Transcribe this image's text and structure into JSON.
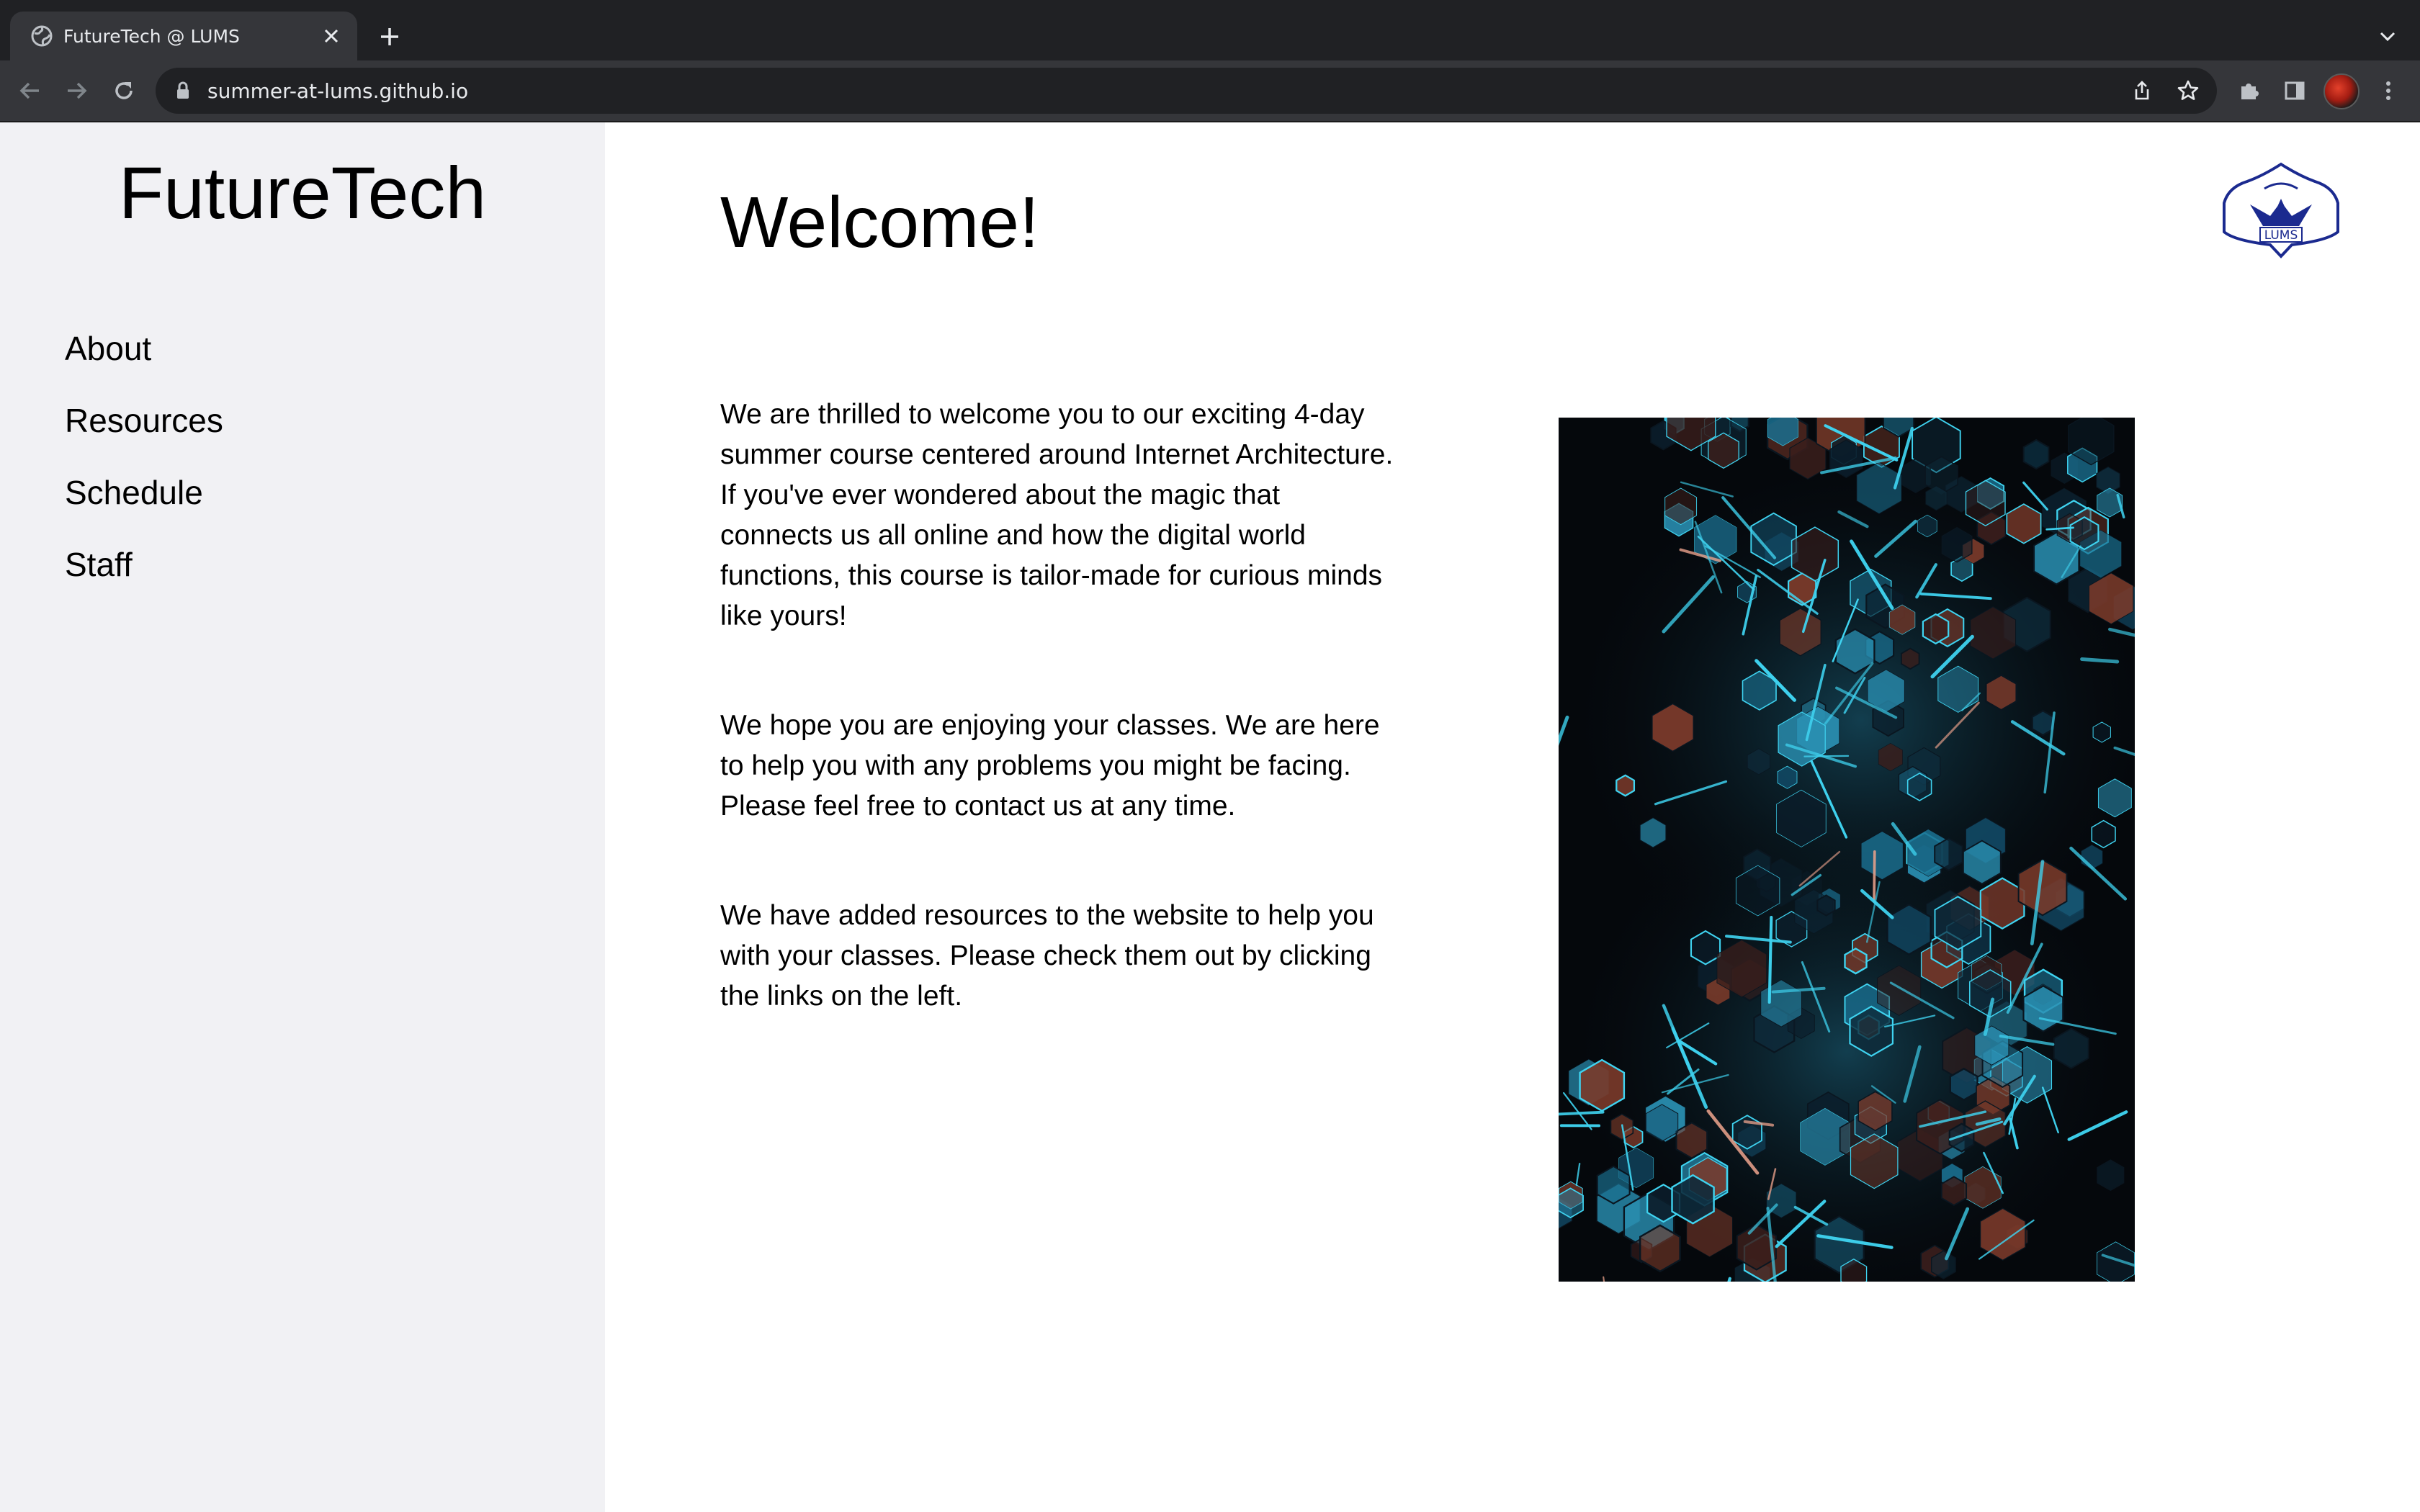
{
  "browser": {
    "tab_title": "FutureTech @ LUMS",
    "url": "summer-at-lums.github.io"
  },
  "sidebar": {
    "brand": "FutureTech",
    "links": [
      {
        "label": "About"
      },
      {
        "label": "Resources"
      },
      {
        "label": "Schedule"
      },
      {
        "label": "Staff"
      }
    ]
  },
  "main": {
    "title": "Welcome!",
    "logo_text": "LUMS",
    "paragraphs": [
      "We are thrilled to welcome you to our exciting 4-day summer course centered around Internet Architecture. If you've ever wondered about the magic that connects us all online and how the digital world functions, this course is tailor-made for curious minds like yours!",
      "We hope you are enjoying your classes. We are here to help you with any problems you might be facing. Please feel free to contact us at any time.",
      "We have added resources to the website to help you with your classes. Please check them out by clicking the links on the left."
    ]
  },
  "colors": {
    "sidebar_bg": "#f1f1f4",
    "chrome_dark": "#202124",
    "chrome_toolbar": "#35363a",
    "logo_blue": "#1b2a8f",
    "hero_accent": "#3fd3f0"
  },
  "icons": [
    "globe-icon",
    "close-icon",
    "plus-icon",
    "chevron-down-icon",
    "back-icon",
    "forward-icon",
    "reload-icon",
    "lock-icon",
    "share-icon",
    "star-icon",
    "extensions-icon",
    "side-panel-icon",
    "menu-icon"
  ]
}
